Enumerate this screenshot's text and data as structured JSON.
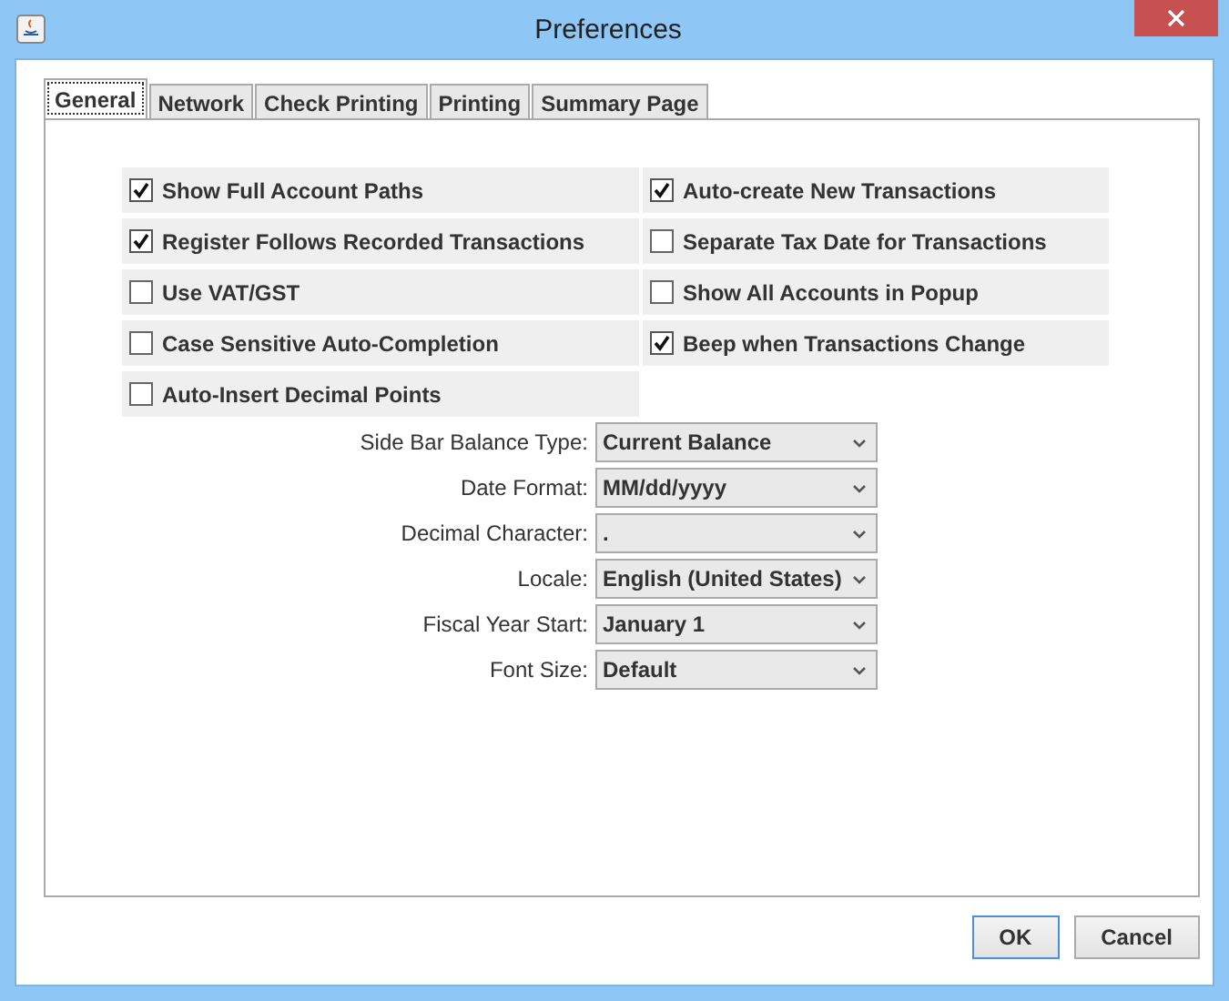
{
  "window": {
    "title": "Preferences"
  },
  "tabs": [
    {
      "label": "General",
      "selected": true
    },
    {
      "label": "Network",
      "selected": false
    },
    {
      "label": "Check Printing",
      "selected": false
    },
    {
      "label": "Printing",
      "selected": false
    },
    {
      "label": "Summary Page",
      "selected": false
    }
  ],
  "options": [
    {
      "label": "Show Full Account Paths",
      "checked": true
    },
    {
      "label": "Auto-create New Transactions",
      "checked": true
    },
    {
      "label": "Register Follows Recorded Transactions",
      "checked": true
    },
    {
      "label": "Separate Tax Date for Transactions",
      "checked": false
    },
    {
      "label": "Use VAT/GST",
      "checked": false
    },
    {
      "label": "Show All Accounts in Popup",
      "checked": false
    },
    {
      "label": "Case Sensitive Auto-Completion",
      "checked": false
    },
    {
      "label": "Beep when Transactions Change",
      "checked": true
    },
    {
      "label": "Auto-Insert Decimal Points",
      "checked": false
    }
  ],
  "settings": [
    {
      "label": "Side Bar Balance Type:",
      "value": "Current Balance"
    },
    {
      "label": "Date Format:",
      "value": "MM/dd/yyyy"
    },
    {
      "label": "Decimal Character:",
      "value": "."
    },
    {
      "label": "Locale:",
      "value": "English (United States)"
    },
    {
      "label": "Fiscal Year Start:",
      "value": "January 1"
    },
    {
      "label": "Font Size:",
      "value": "Default"
    }
  ],
  "buttons": [
    {
      "label": "OK",
      "selected": true
    },
    {
      "label": "Cancel",
      "selected": false
    }
  ]
}
